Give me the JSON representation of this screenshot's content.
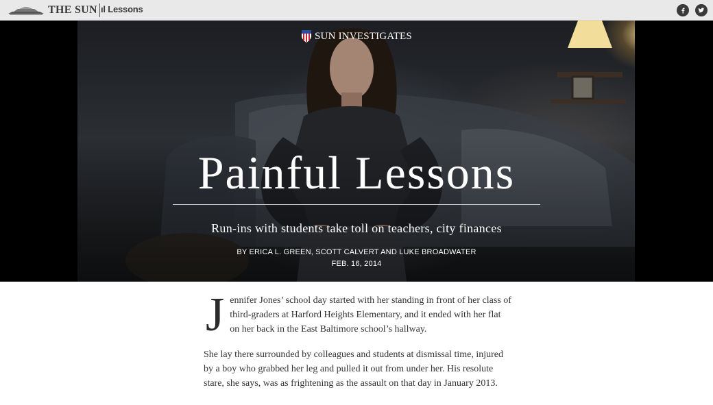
{
  "header": {
    "logo_text": "THE SUN",
    "nav_title": "ıl Lessons",
    "social": [
      {
        "name": "facebook",
        "icon": "facebook-icon"
      },
      {
        "name": "twitter",
        "icon": "twitter-icon"
      }
    ]
  },
  "hero": {
    "kicker": "SUN INVESTIGATES",
    "kicker_icon": "shield-flag-icon",
    "headline": "Painful Lessons",
    "subhead": "Run-ins with students take toll on teachers, city finances",
    "byline": "BY ERICA L. GREEN, SCOTT CALVERT AND LUKE BROADWATER",
    "date": "FEB. 16, 2014"
  },
  "article": {
    "dropcap": "J",
    "paragraph1": "ennifer Jones’ school day started with her standing in front of her class of third-graders at Harford Heights Elementary, and it ended with her flat on her back in the East Baltimore school’s hallway.",
    "paragraph2": "She lay there surrounded by colleagues and students at dismissal time, injured by a boy who grabbed her leg and pulled it out from under her. His resolute stare, she says, was as frightening as the assault on that day in January 2013."
  },
  "colors": {
    "topbar_bg": "#e9e9e9",
    "hero_bg": "#000000",
    "text": "#333333",
    "hero_text": "#ffffff"
  }
}
